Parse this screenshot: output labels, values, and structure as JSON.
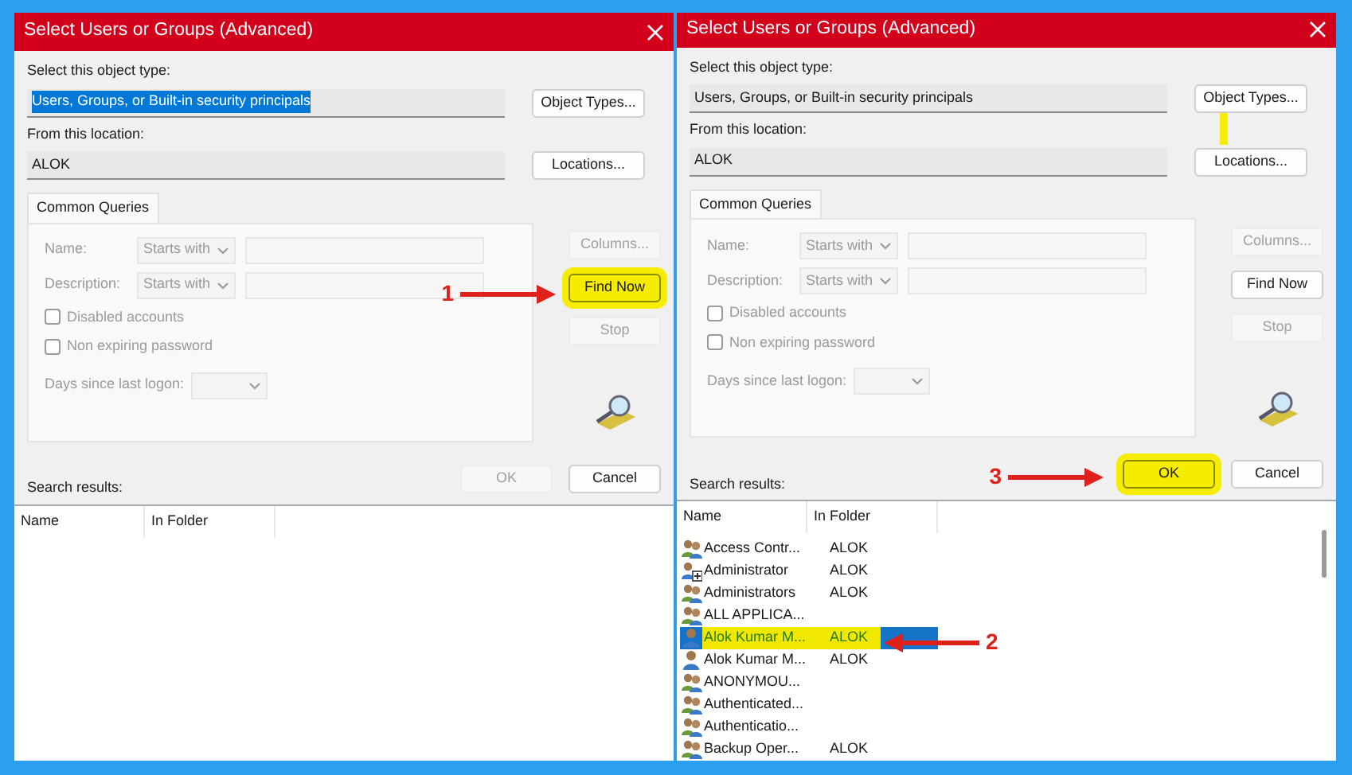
{
  "dialogs": [
    {
      "title": "Select Users or Groups (Advanced)",
      "object_type": {
        "label": "Select this object type:",
        "value": "Users, Groups, or Built-in security principals",
        "text_selected": true
      },
      "object_types_button": {
        "label": "Object Types..."
      },
      "location": {
        "label": "From this location:",
        "value": "ALOK"
      },
      "locations_button": {
        "label": "Locations..."
      },
      "query_tab": {
        "label": "Common Queries",
        "disabled": true,
        "fields": [
          {
            "label": "Name:",
            "operator": "Starts with"
          },
          {
            "label": "Description:",
            "operator": "Starts with"
          }
        ],
        "checkboxes": [
          {
            "label": "Disabled accounts",
            "checked": false
          },
          {
            "label": "Non expiring password",
            "checked": false
          }
        ],
        "days_label": "Days since last logon:"
      },
      "side_buttons": [
        {
          "label": "Columns...",
          "disabled": true,
          "highlighted": false
        },
        {
          "label": "Find Now",
          "disabled": false,
          "highlighted": true,
          "callout": "1"
        },
        {
          "label": "Stop",
          "disabled": true,
          "highlighted": false
        }
      ],
      "ok_button": {
        "label": "OK",
        "disabled": true,
        "highlighted": false
      },
      "cancel_button": {
        "label": "Cancel"
      },
      "results_label": "Search results:",
      "columns": [
        "Name",
        "In Folder"
      ]
    },
    {
      "title": "Select Users or Groups (Advanced)",
      "object_type": {
        "label": "Select this object type:",
        "value": "Users, Groups, or Built-in security principals",
        "text_selected": false
      },
      "object_types_button": {
        "label": "Object Types...",
        "connector": true
      },
      "location": {
        "label": "From this location:",
        "value": "ALOK"
      },
      "locations_button": {
        "label": "Locations..."
      },
      "query_tab": {
        "label": "Common Queries",
        "disabled": true,
        "fields": [
          {
            "label": "Name:",
            "operator": "Starts with"
          },
          {
            "label": "Description:",
            "operator": "Starts with"
          }
        ],
        "checkboxes": [
          {
            "label": "Disabled accounts",
            "checked": false
          },
          {
            "label": "Non expiring password",
            "checked": false
          }
        ],
        "days_label": "Days since last logon:"
      },
      "side_buttons": [
        {
          "label": "Columns...",
          "disabled": true,
          "highlighted": false
        },
        {
          "label": "Find Now",
          "disabled": false,
          "highlighted": false
        },
        {
          "label": "Stop",
          "disabled": true,
          "highlighted": false
        }
      ],
      "ok_button": {
        "label": "OK",
        "disabled": false,
        "highlighted": true,
        "callout": "3"
      },
      "cancel_button": {
        "label": "Cancel"
      },
      "results_label": "Search results:",
      "columns": [
        "Name",
        "In Folder"
      ],
      "rows": [
        {
          "kind": "group",
          "name": "Access Contr...",
          "folder": "ALOK",
          "selected": false,
          "highlighted": false
        },
        {
          "kind": "admin",
          "name": "Administrator",
          "folder": "ALOK",
          "selected": false,
          "highlighted": false
        },
        {
          "kind": "group",
          "name": "Administrators",
          "folder": "ALOK",
          "selected": false,
          "highlighted": false
        },
        {
          "kind": "group",
          "name": "ALL APPLICA...",
          "selected": false,
          "highlighted": false
        },
        {
          "kind": "user",
          "name": "Alok Kumar M...",
          "folder": "ALOK",
          "selected": true,
          "highlighted": true,
          "callout": "2"
        },
        {
          "kind": "user",
          "name": "Alok Kumar M...",
          "folder": "ALOK",
          "selected": false,
          "highlighted": false
        },
        {
          "kind": "group",
          "name": "ANONYMOU...",
          "selected": false,
          "highlighted": false
        },
        {
          "kind": "group",
          "name": "Authenticated...",
          "selected": false,
          "highlighted": false
        },
        {
          "kind": "group",
          "name": "Authenticatio...",
          "selected": false,
          "highlighted": false
        },
        {
          "kind": "group",
          "name": "Backup Oper...",
          "folder": "ALOK",
          "selected": false,
          "highlighted": false
        }
      ]
    }
  ]
}
